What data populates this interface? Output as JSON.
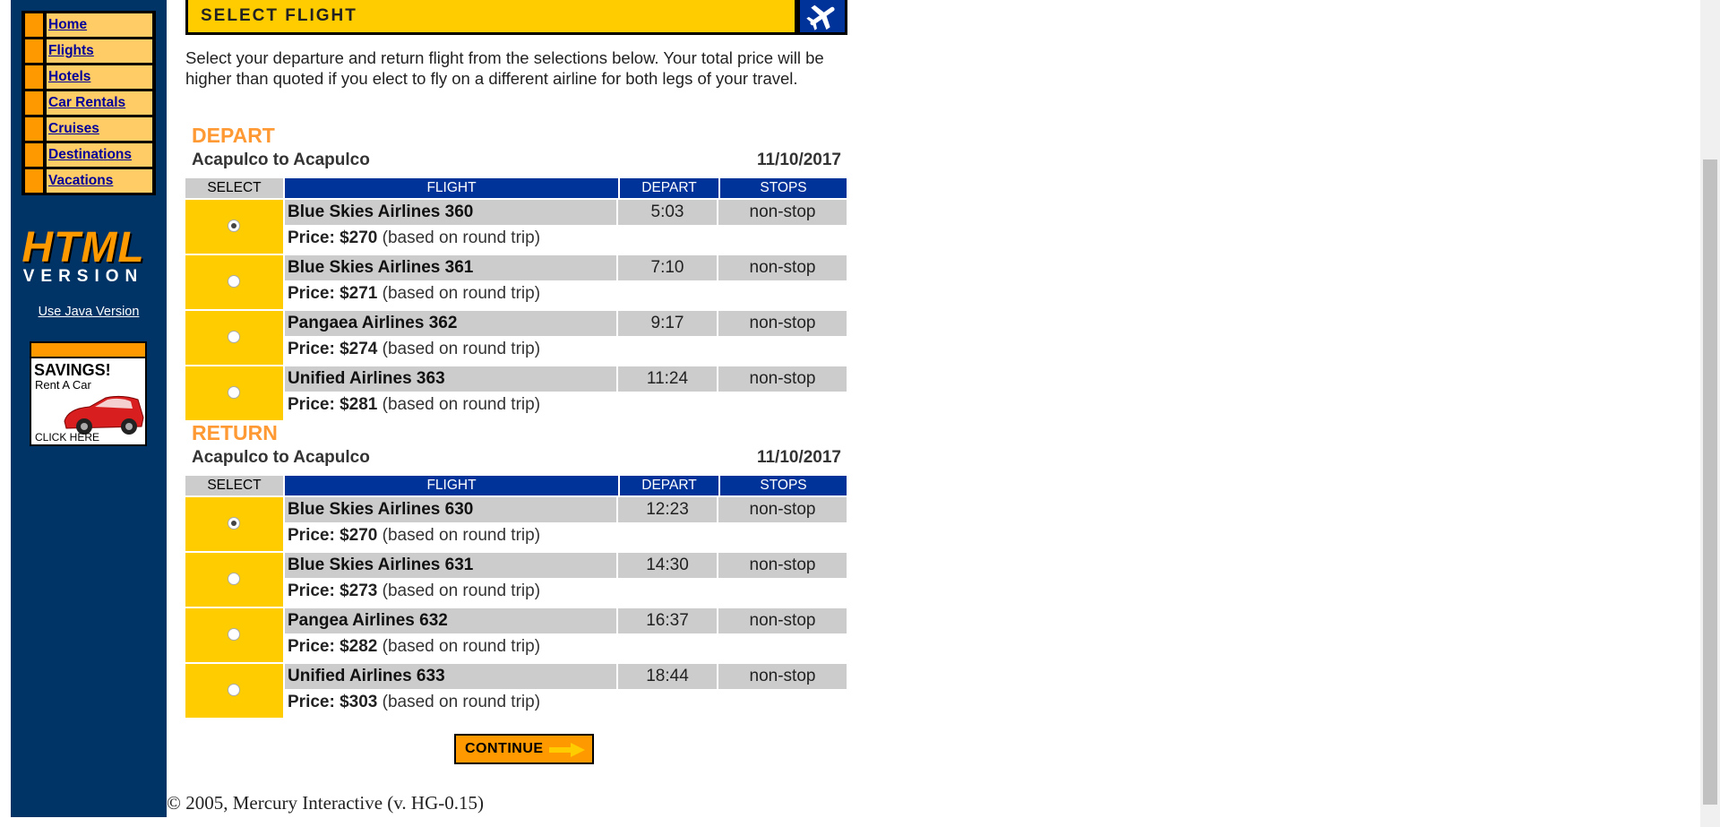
{
  "nav": {
    "items": [
      {
        "label": "Home"
      },
      {
        "label": "Flights"
      },
      {
        "label": "Hotels"
      },
      {
        "label": "Car Rentals"
      },
      {
        "label": "Cruises"
      },
      {
        "label": "Destinations"
      },
      {
        "label": "Vacations"
      }
    ]
  },
  "logo": {
    "html": "HTML",
    "version": "VERSION",
    "java_link": "Use Java Version"
  },
  "ad": {
    "title": "SAVINGS!",
    "subtitle": "Rent A Car",
    "cta": "CLICK HERE"
  },
  "banner": {
    "title": "SELECT FLIGHT"
  },
  "intro": "Select your departure and return flight from the selections below. Your total price will be higher than quoted if you elect to fly on a different airline for both legs of your travel.",
  "headers": {
    "select": "SELECT",
    "flight": "FLIGHT",
    "depart": "DEPART",
    "stops": "STOPS"
  },
  "depart": {
    "title": "DEPART",
    "route": "Acapulco to Acapulco",
    "date": "11/10/2017",
    "flights": [
      {
        "name": "Blue Skies Airlines 360",
        "time": "5:03",
        "stops": "non-stop",
        "price_label": "Price: $270",
        "price_note": "(based on round trip)",
        "selected": true
      },
      {
        "name": "Blue Skies Airlines 361",
        "time": "7:10",
        "stops": "non-stop",
        "price_label": "Price: $271",
        "price_note": "(based on round trip)",
        "selected": false
      },
      {
        "name": "Pangaea Airlines 362",
        "time": "9:17",
        "stops": "non-stop",
        "price_label": "Price: $274",
        "price_note": "(based on round trip)",
        "selected": false
      },
      {
        "name": "Unified Airlines 363",
        "time": "11:24",
        "stops": "non-stop",
        "price_label": "Price: $281",
        "price_note": "(based on round trip)",
        "selected": false
      }
    ]
  },
  "return": {
    "title": "RETURN",
    "route": "Acapulco to Acapulco",
    "date": "11/10/2017",
    "flights": [
      {
        "name": "Blue Skies Airlines 630",
        "time": "12:23",
        "stops": "non-stop",
        "price_label": "Price: $270",
        "price_note": "(based on round trip)",
        "selected": true
      },
      {
        "name": "Blue Skies Airlines 631",
        "time": "14:30",
        "stops": "non-stop",
        "price_label": "Price: $273",
        "price_note": "(based on round trip)",
        "selected": false
      },
      {
        "name": "Pangea Airlines 632",
        "time": "16:37",
        "stops": "non-stop",
        "price_label": "Price: $282",
        "price_note": "(based on round trip)",
        "selected": false
      },
      {
        "name": "Unified Airlines 633",
        "time": "18:44",
        "stops": "non-stop",
        "price_label": "Price: $303",
        "price_note": "(based on round trip)",
        "selected": false
      }
    ]
  },
  "continue_label": "CONTINUE",
  "footer": "© 2005, Mercury Interactive (v. HG-0.15)",
  "colors": {
    "sidebar": "#003366",
    "accent": "#ffcc00",
    "header": "#003399",
    "section": "#ff9933"
  }
}
